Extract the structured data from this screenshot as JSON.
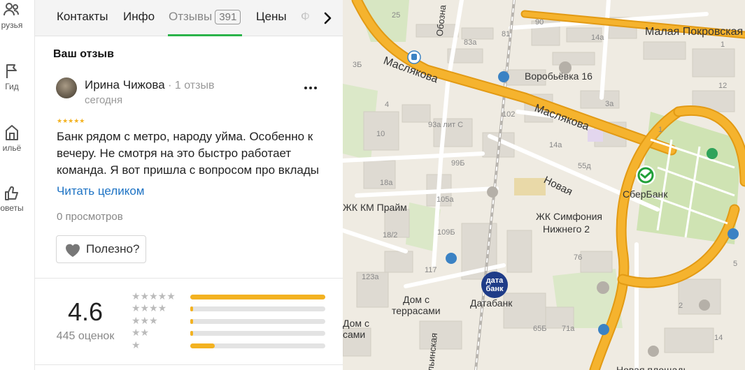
{
  "rail": {
    "items": [
      {
        "label": "рузья",
        "icon": "people-icon"
      },
      {
        "label": "Гид",
        "icon": "flag-icon"
      },
      {
        "label": "ильё",
        "icon": "house-icon"
      },
      {
        "label": "оветы",
        "icon": "thumbs-up-icon"
      }
    ]
  },
  "tabs": {
    "items": [
      {
        "label": "Контакты"
      },
      {
        "label": "Инфо"
      },
      {
        "label": "Отзывы",
        "badge": "391",
        "active": true
      },
      {
        "label": "Цены"
      },
      {
        "label": "Ф"
      }
    ]
  },
  "review": {
    "section_title": "Ваш отзыв",
    "author": "Ирина Чижова",
    "author_meta": " · 1 отзыв",
    "date": "сегодня",
    "stars_value": 5,
    "stars_text": "★★★★★",
    "text_lines": [
      "Банк рядом с метро, народу уйма. Особенно к",
      "вечеру. Не смотря на это быстро работает",
      "команда. Я вот пришла с вопросом про вклады"
    ],
    "read_more": "Читать целиком",
    "views": "0 просмотров",
    "helpful_label": "Полезно?"
  },
  "rating": {
    "value": "4.6",
    "count": "445 оценок",
    "distribution": [
      {
        "stars": "★★★★★",
        "fraction": 1.0
      },
      {
        "stars": "★★★★",
        "fraction": 0.02
      },
      {
        "stars": "★★★",
        "fraction": 0.02
      },
      {
        "stars": "★★",
        "fraction": 0.02
      },
      {
        "stars": "★",
        "fraction": 0.18
      }
    ]
  },
  "map": {
    "colors": {
      "road_main": "#f5b32e",
      "road_edge": "#e29a14",
      "background": "#efebe2",
      "park": "#cfe3b3",
      "building": "#dedad2",
      "sber": "#21a038",
      "databank": "#1f3c88"
    },
    "labels": {
      "street_top_right": "Малая Покровская",
      "street_maslyakova_1": "Маслякова",
      "street_maslyakova_2": "Маслякова",
      "street_novaya": "Новая",
      "street_obozna": "Обозна",
      "vorobievka": "Воробьёвка 16",
      "zhk_symphony_1": "ЖК Симфония",
      "zhk_symphony_2": "Нижнего 2",
      "zhk_prime": "ЖК КМ Прайм",
      "dom_1": "Дом с",
      "dom_2": "террасами",
      "dom2_1": "Дом с",
      "dom2_2": "сами",
      "novaya_ploshad": "Новая площадь",
      "ilyinskaya": "льинская",
      "sber_name": "СберБанк",
      "databank_name": "Датабанк",
      "databank_logo_1": "дата",
      "databank_logo_2": "банк"
    },
    "house_numbers": [
      "25",
      "81",
      "90",
      "14а",
      "83а",
      "3Б",
      "4",
      "102",
      "3а",
      "1",
      "93а лит С",
      "10",
      "14а",
      "55д",
      "99Б",
      "18а",
      "105а",
      "18/2",
      "109Б",
      "76",
      "117",
      "123а",
      "65Б",
      "71а",
      "2",
      "12",
      "5",
      "14",
      "1"
    ]
  }
}
